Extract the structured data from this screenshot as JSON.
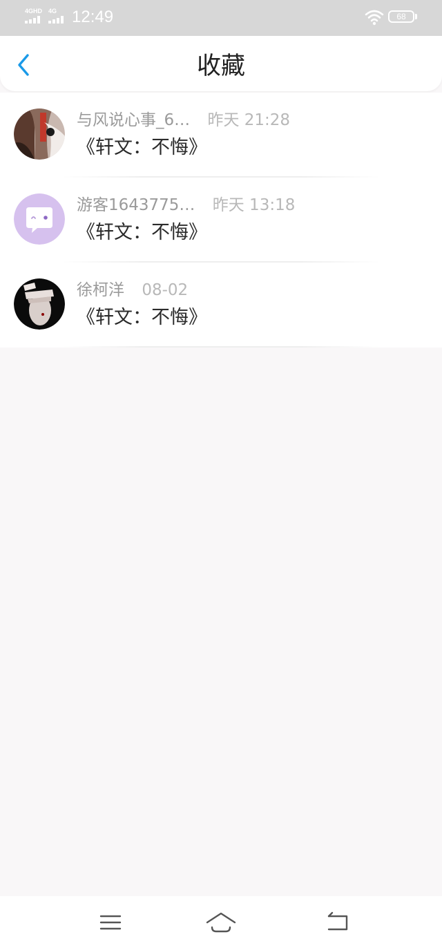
{
  "status_bar": {
    "network_1": "4GHD",
    "network_2": "4G",
    "time": "12:49",
    "battery": "68"
  },
  "header": {
    "title": "收藏",
    "back_icon": "chevron-left-icon"
  },
  "favorites": [
    {
      "author": "与风说心事_6…",
      "time": "昨天 21:28",
      "title": "《轩文：不悔》"
    },
    {
      "author": "游客1643775…",
      "time": "昨天 13:18",
      "title": "《轩文：不悔》"
    },
    {
      "author": "徐柯洋",
      "time": "08-02",
      "title": "《轩文：不悔》"
    }
  ],
  "system_nav": {
    "menu_icon": "menu-icon",
    "home_icon": "home-icon",
    "back_icon": "back-icon"
  },
  "colors": {
    "accent": "#1a9ae8",
    "status_bar_bg": "#d7d7d7",
    "page_bg": "#f9f7f8"
  }
}
